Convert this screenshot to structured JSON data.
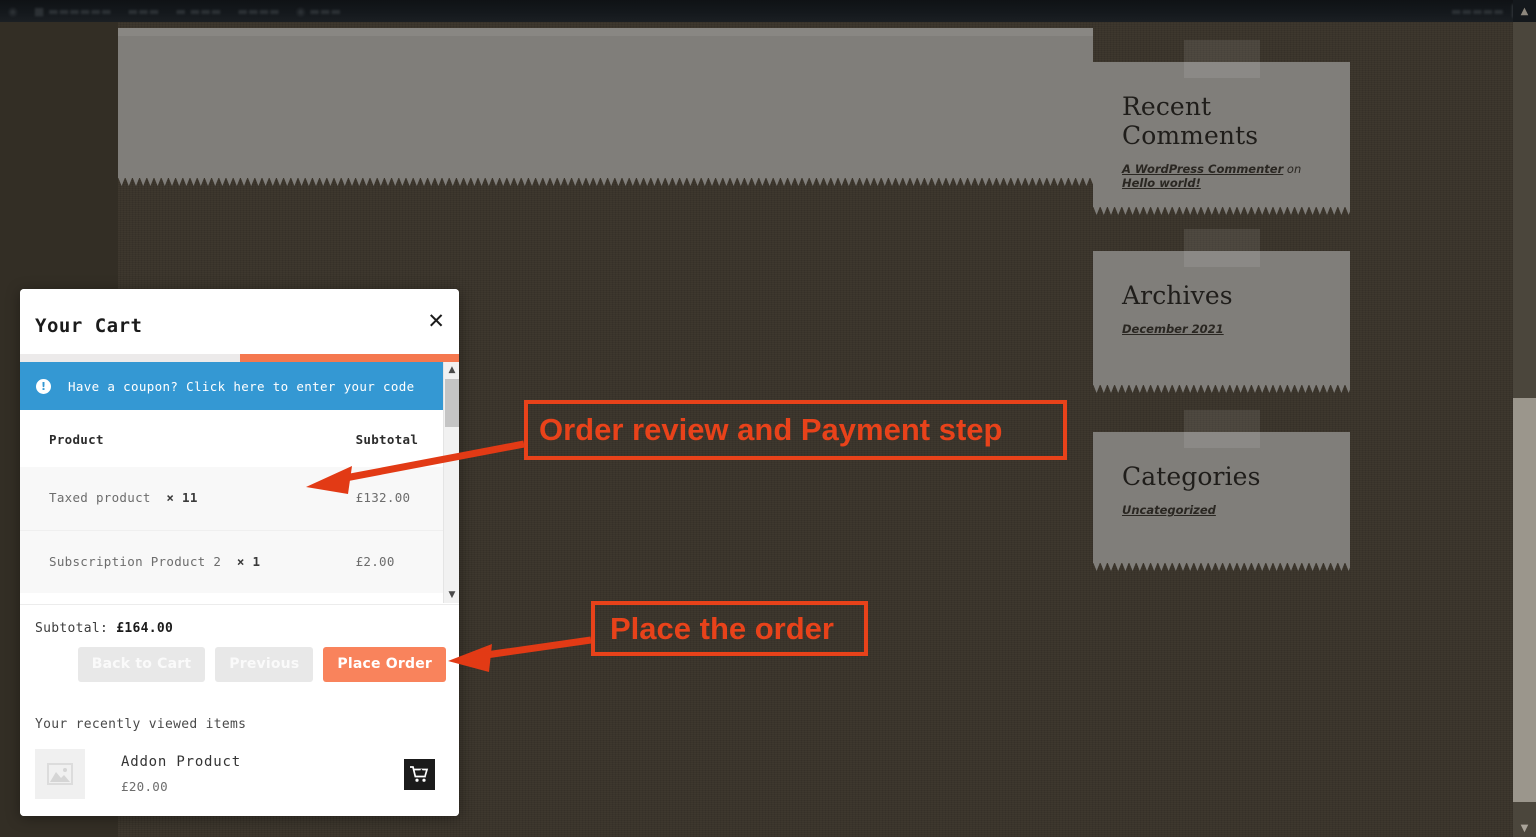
{
  "admin_bar": {
    "items": [
      "",
      "",
      "",
      "",
      "",
      "",
      ""
    ],
    "right_items": [
      "",
      ""
    ]
  },
  "sidebar": {
    "widgets": [
      {
        "title": "Recent Comments",
        "entries": [
          {
            "author": "A WordPress Commenter",
            "connector": " on ",
            "post": "Hello world!"
          }
        ]
      },
      {
        "title": "Archives",
        "links": [
          "December 2021"
        ]
      },
      {
        "title": "Categories",
        "links": [
          "Uncategorized"
        ]
      }
    ]
  },
  "cart": {
    "title": "Your Cart",
    "close_label": "✕",
    "progress_percent": 50,
    "coupon": {
      "icon": "info-icon",
      "text": "Have a coupon? Click here to enter your code"
    },
    "table": {
      "headers": [
        "Product",
        "Subtotal"
      ],
      "rows": [
        {
          "name": "Taxed product",
          "qty": "× 11",
          "subtotal": "£132.00"
        },
        {
          "name": "Subscription Product 2",
          "qty": "× 1",
          "subtotal": "£2.00"
        }
      ]
    },
    "subtotal_label": "Subtotal:",
    "subtotal_value": "£164.00",
    "buttons": [
      {
        "label": "Back to Cart",
        "style": "muted"
      },
      {
        "label": "Previous",
        "style": "muted"
      },
      {
        "label": "Place Order",
        "style": "primary"
      }
    ],
    "recently_viewed": {
      "title": "Your recently viewed items",
      "item": {
        "name": "Addon Product",
        "price": "£20.00",
        "thumb": "placeholder-image-icon",
        "add_icon": "add-to-cart-icon"
      }
    }
  },
  "annotations": [
    {
      "text": "Order review and Payment step",
      "color": "#e8421a"
    },
    {
      "text": "Place the order",
      "color": "#e8421a"
    }
  ],
  "colors": {
    "annotation": "#e8421a",
    "accent_orange": "#f5784f",
    "coupon_blue": "#3498d3",
    "page_background": "#3a342a",
    "widget_background": "#807e7a"
  }
}
